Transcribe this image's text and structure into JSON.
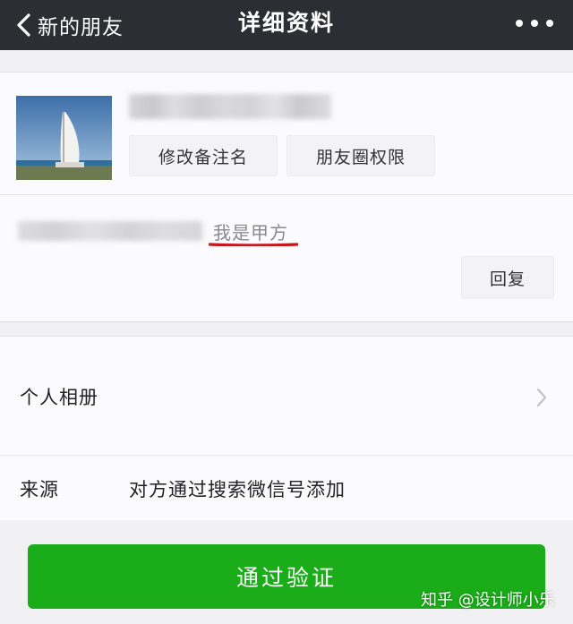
{
  "navbar": {
    "back_label": "新的朋友",
    "title": "详细资料"
  },
  "profile": {
    "remark_button": "修改备注名",
    "moments_button": "朋友圈权限"
  },
  "message": {
    "text": "我是甲方",
    "reply_button": "回复"
  },
  "rows": {
    "album_label": "个人相册",
    "source_label": "来源",
    "source_value": "对方通过搜索微信号添加"
  },
  "action": {
    "verify_button": "通过验证"
  },
  "watermark": "知乎 @设计师小乐",
  "colors": {
    "navbar_bg": "#2d2e33",
    "primary_green": "#1aad19",
    "underline_red": "#c8181e",
    "page_bg": "#f1f1f3"
  },
  "icons": {
    "back": "chevron-left-icon",
    "more": "more-dots-icon",
    "row_arrow": "chevron-right-icon"
  }
}
